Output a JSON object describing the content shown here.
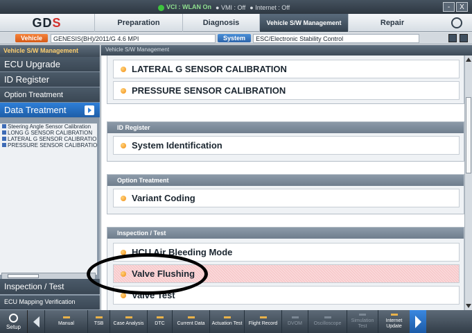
{
  "status": {
    "vci": "VCI : WLAN On",
    "vmi": "VMI : Off",
    "internet": "Internet : Off"
  },
  "window_buttons": [
    "-",
    "X"
  ],
  "logo": {
    "left": "G",
    "mid": "D",
    "right": "S"
  },
  "tabs": [
    {
      "label": "Preparation"
    },
    {
      "label": "Diagnosis"
    },
    {
      "label": "Vehicle S/W Management"
    },
    {
      "label": "Repair"
    }
  ],
  "vehicle_bar": {
    "vehicle_button": "Vehicle",
    "vehicle_name": "GENESIS(BH)/2011/G 4.6 MPI",
    "system_button": "System",
    "system_name": "ESC/Electronic Stability Control"
  },
  "sidebar": {
    "header": "Vehicle S/W Management",
    "items": [
      "ECU Upgrade",
      "ID Register",
      "Option Treatment",
      "Data Treatment"
    ],
    "tree": [
      "Steering Angle Sensor Calibration",
      "LONG G SENSOR CALIBRATION",
      "LATERAL G SENSOR CALIBRATION",
      "PRESSURE SENSOR CALIBRATION"
    ],
    "bottom1": "Inspection / Test",
    "bottom2": "ECU Mapping Verification"
  },
  "main": {
    "header": "Vehicle S/W Management",
    "data_items": [
      "LATERAL G SENSOR CALIBRATION",
      "PRESSURE SENSOR CALIBRATION"
    ],
    "id_register": {
      "title": "ID Register",
      "items": [
        "System Identification"
      ]
    },
    "option_treatment": {
      "title": "Option Treatment",
      "items": [
        "Variant Coding"
      ]
    },
    "inspection": {
      "title": "Inspection / Test",
      "items": [
        "HCU Air Bleeding Mode",
        "Valve Flushing",
        "Valve Test"
      ]
    }
  },
  "bottom": {
    "setup": "Setup",
    "buttons": [
      "Manual",
      "TSB",
      "Case Analysis",
      "DTC",
      "Current Data",
      "Actuation Test",
      "Flight Record",
      "DVOM",
      "Oscilloscope",
      "Simulation Test",
      "Internet Update"
    ]
  }
}
